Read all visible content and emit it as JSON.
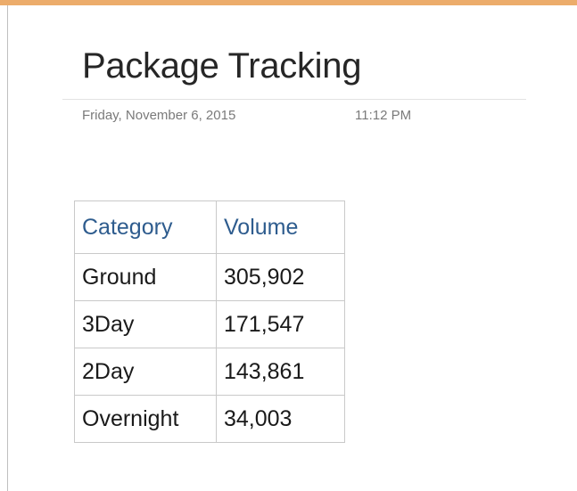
{
  "page": {
    "title": "Package Tracking",
    "date": "Friday, November 6, 2015",
    "time": "11:12 PM"
  },
  "colors": {
    "accent": "#ecac6b",
    "header_text": "#2e5c8e",
    "meta_text": "#7a7a7a",
    "table_border": "#c9c9c9"
  },
  "table": {
    "headers": [
      "Category",
      "Volume"
    ],
    "rows": [
      [
        "Ground",
        "305,902"
      ],
      [
        "3Day",
        "171,547"
      ],
      [
        "2Day",
        "143,861"
      ],
      [
        "Overnight",
        "34,003"
      ]
    ]
  }
}
